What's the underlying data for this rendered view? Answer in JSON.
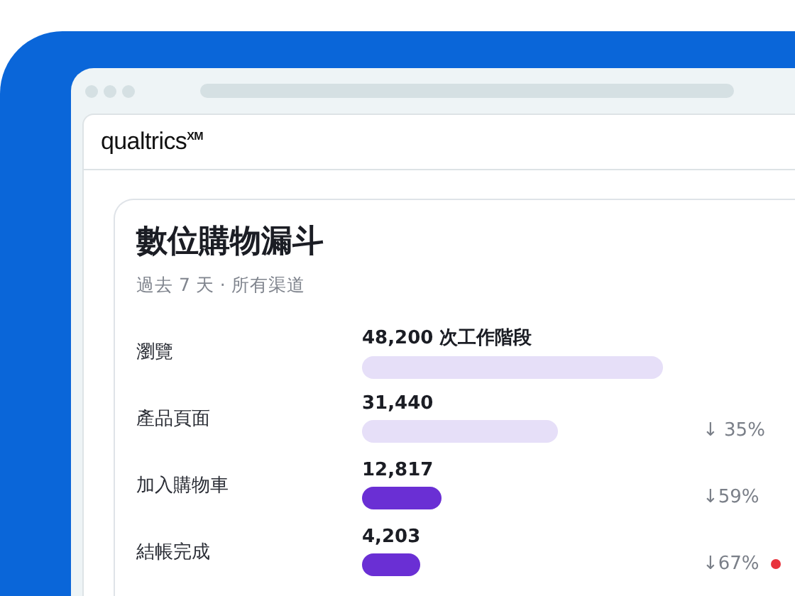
{
  "browser": {
    "logo": "qualtrics$^{XM}$"
  },
  "card": {
    "title": "數位購物漏斗",
    "subtitle": "過去 7 天 · 所有渠道",
    "steps": [
      {
        "label": "瀏覽",
        "value": "48,200 次工作階段",
        "highlighted": false,
        "alert": false
      },
      {
        "label": "產品頁面",
        "value": "31,440",
        "highlighted": false,
        "drop": "↓ 35%",
        "alert": false
      },
      {
        "label": "加入購物車",
        "value": "12,817",
        "highlighted": true,
        "drop": "↓59%",
        "alert": false
      },
      {
        "label": "結帳完成",
        "value": "4,203",
        "highlighted": true,
        "drop": "↓67%",
        "alert": true
      }
    ]
  }
}
